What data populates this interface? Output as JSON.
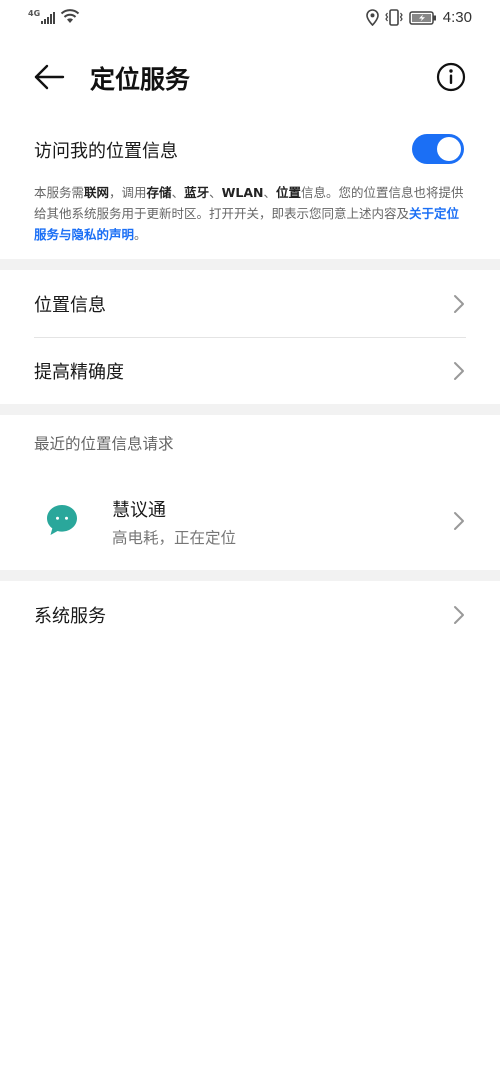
{
  "status_bar": {
    "network_type": "4G",
    "time": "4:30"
  },
  "header": {
    "title": "定位服务",
    "back_icon": "arrow-left-icon",
    "info_icon": "info-circle-icon"
  },
  "location_access": {
    "label": "访问我的位置信息",
    "toggle_on": true,
    "accent_color": "#1b6ff5"
  },
  "description": {
    "t1": "本服务需",
    "b1": "联网",
    "t2": "，调用",
    "b2": "存储",
    "t3": "、",
    "b3": "蓝牙",
    "t4": "、",
    "b4": "WLAN",
    "t5": "、",
    "b5": "位置",
    "t6": "信息。您的位置信息也将提供给其他系统服务用于更新时区。打开开关，即表示您同意上述内容及",
    "link": "关于定位服务与隐私的声明",
    "t7": "。"
  },
  "items": {
    "location_info": "位置信息",
    "improve_accuracy": "提高精确度",
    "system_services": "系统服务"
  },
  "recent_requests": {
    "title": "最近的位置信息请求",
    "apps": [
      {
        "name": "慧议通",
        "status": "高电耗，正在定位",
        "icon": "chat-bubble-icon",
        "icon_color": "#2aa79b"
      }
    ]
  }
}
